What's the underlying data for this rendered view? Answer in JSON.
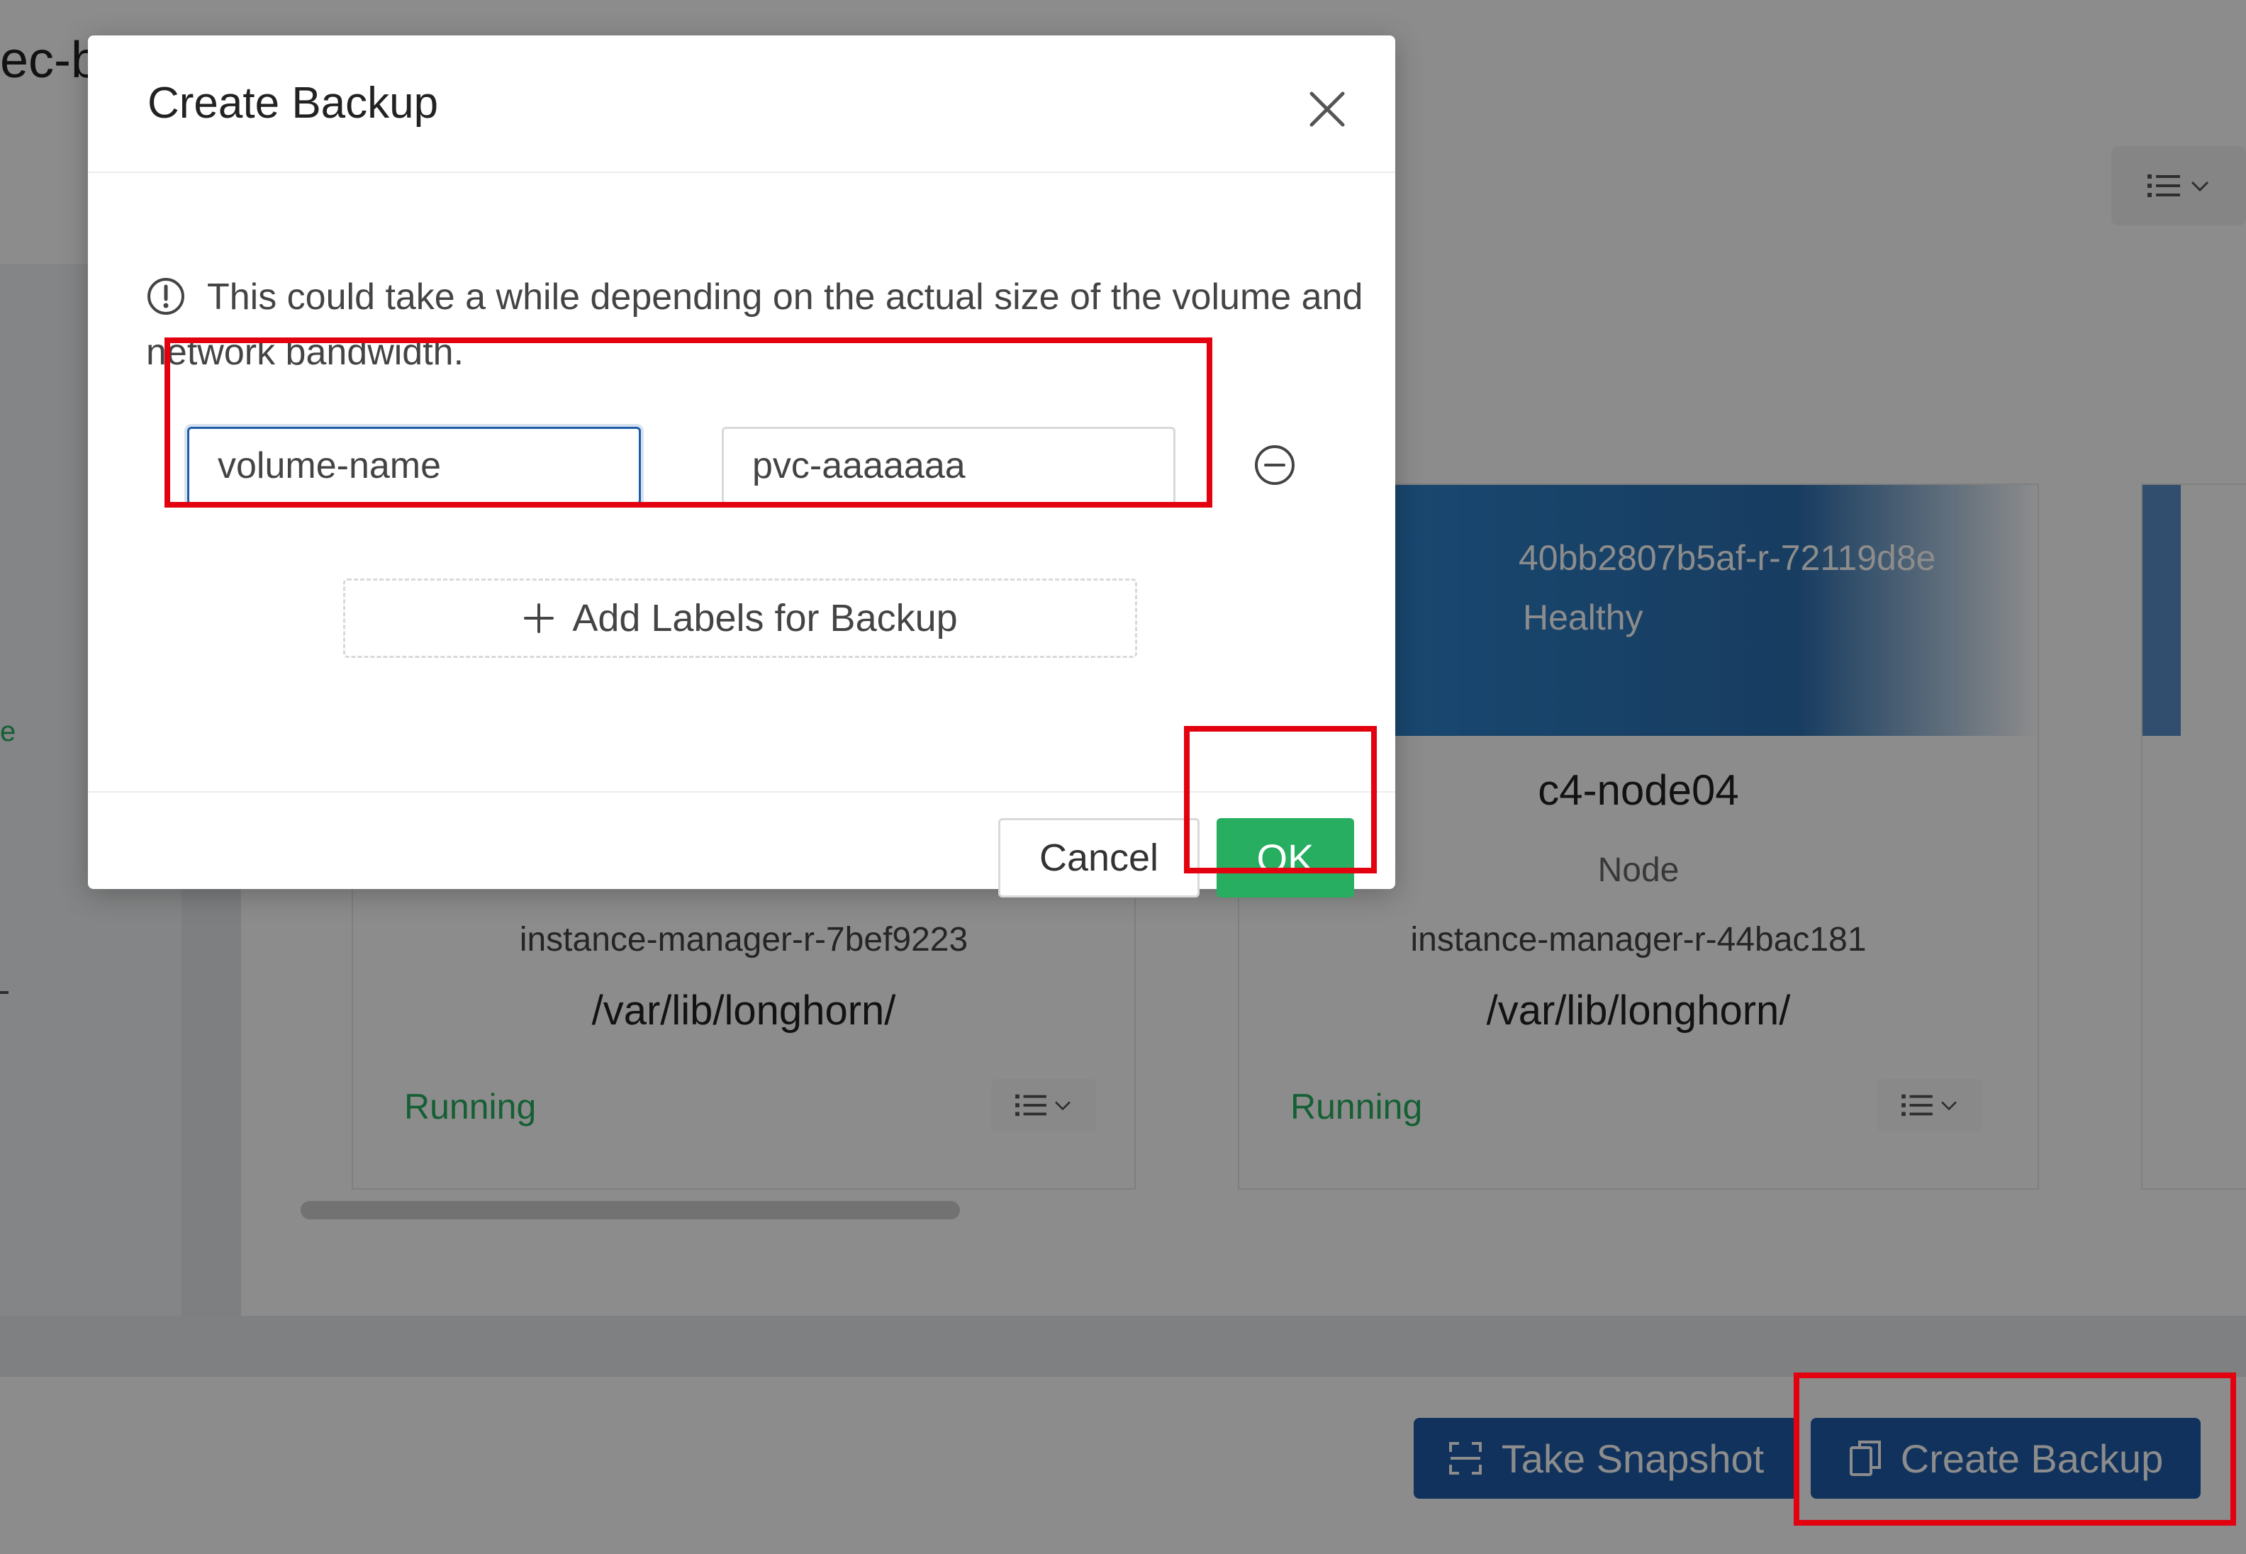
{
  "page": {
    "title_fragment": "ec-b",
    "status_fragment": "e",
    "cards": [
      {
        "instance_manager": "instance-manager-r-7bef9223",
        "path": "/var/lib/longhorn/",
        "status": "Running"
      },
      {
        "replica_id": "40bb2807b5af-r-72119d8e",
        "replica_health": "Healthy",
        "node": "c4-node04",
        "type": "Node",
        "instance_manager": "instance-manager-r-44bac181",
        "path": "/var/lib/longhorn/",
        "status": "Running"
      }
    ],
    "footer": {
      "take_snapshot_label": "Take Snapshot",
      "create_backup_label": "Create Backup"
    }
  },
  "modal": {
    "title": "Create Backup",
    "info_text": "This could take a while depending on the actual size of the volume and network bandwidth.",
    "label_key_value": "volume-name",
    "label_value_value": "pvc-aaaaaaa",
    "add_labels_label": "Add Labels for Backup",
    "cancel_label": "Cancel",
    "ok_label": "OK"
  },
  "colors": {
    "primary": "#1f5ca8",
    "success": "#27ae60",
    "highlight": "#e3000f"
  }
}
